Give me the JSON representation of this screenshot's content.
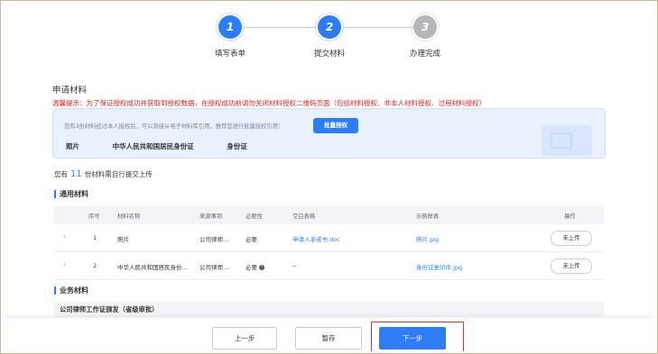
{
  "steps": [
    {
      "number": "1",
      "label": "填写表单",
      "state": "done"
    },
    {
      "number": "2",
      "label": "提交材料",
      "state": "active"
    },
    {
      "number": "3",
      "label": "办理完成",
      "state": "todo"
    }
  ],
  "section_title": "申请材料",
  "warning": "温馨提示：为了保证授权成功并获取到授权数据，在授权成功前请勿关闭材料授权二维码页面（包括材料授权、非本人材料授权、过程材料授权）",
  "auth_box": {
    "tip": "您有3份材料经过本人授权后，可以直接从电子材料库引用，推荐您进行批量授权引用：",
    "batch_button": "批量授权",
    "items": [
      "照片",
      "中华人民共和国居民身份证",
      "身份证"
    ]
  },
  "count_line": {
    "prefix": "您有",
    "count": "11",
    "suffix": "份材料需自行提交上传"
  },
  "general_title": "通用材料",
  "table": {
    "headers": {
      "index": "序号",
      "name": "材料名称",
      "source": "来源事项",
      "required": "必要性",
      "blank_form": "空白表格",
      "sample": "示例样表",
      "action": "操作"
    },
    "rows": [
      {
        "index": "1",
        "name": "照片",
        "source": "公司律师…",
        "required": "必要",
        "blank_form": "申请人承诺书.doc",
        "sample": "照片.jpg",
        "action": "未上传"
      },
      {
        "index": "2",
        "name": "中华人民共和国居民身份…",
        "source": "公司律师…",
        "required": "必要",
        "blank_form": "--",
        "sample": "身份证复印件.jpg",
        "action": "未上传"
      }
    ]
  },
  "business_title": "业务材料",
  "business_item": "公司律师工作证颁发（省级审批）",
  "footer": {
    "prev": "上一步",
    "save": "暂存",
    "next": "下一步"
  },
  "colors": {
    "accent": "#2f7df6",
    "warning": "#e02020",
    "highlight": "#e03030"
  }
}
